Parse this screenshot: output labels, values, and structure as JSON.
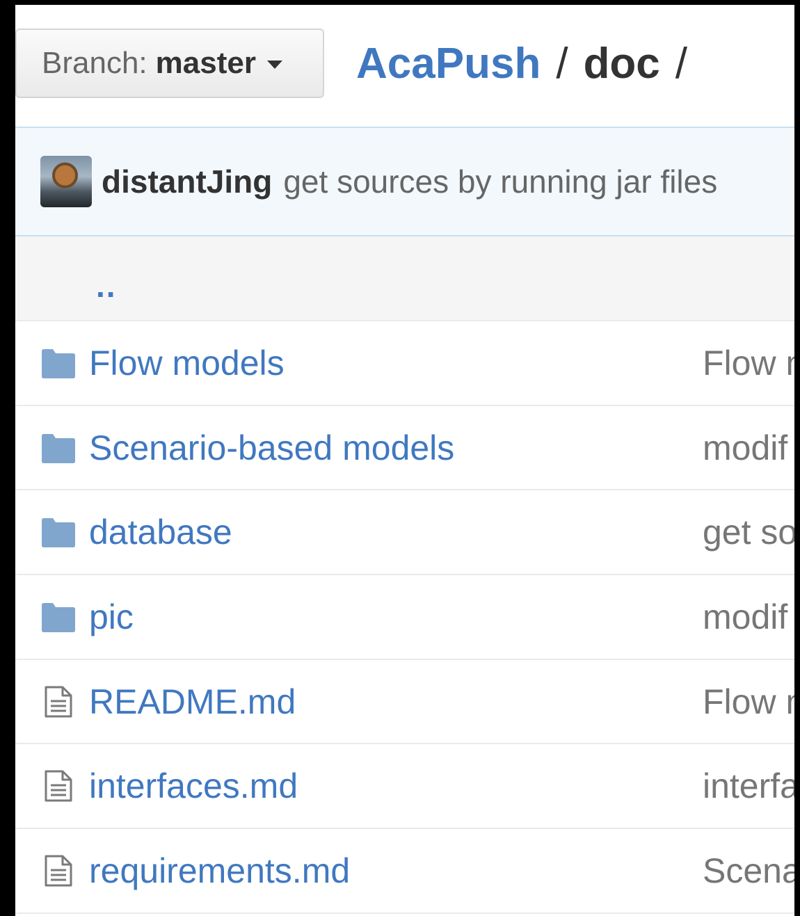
{
  "header": {
    "branch_prefix": "Branch:",
    "branch_name": "master",
    "repo": "AcaPush",
    "separator": "/",
    "directory": "doc",
    "trailing_separator": "/"
  },
  "commit": {
    "author": "distantJing",
    "message": "get sources by running jar files"
  },
  "parent_dir": "..",
  "files": [
    {
      "type": "folder",
      "name": "Flow models",
      "message": "Flow m"
    },
    {
      "type": "folder",
      "name": "Scenario-based models",
      "message": "modif"
    },
    {
      "type": "folder",
      "name": "database",
      "message": "get so"
    },
    {
      "type": "folder",
      "name": "pic",
      "message": "modif"
    },
    {
      "type": "file",
      "name": "README.md",
      "message": "Flow m"
    },
    {
      "type": "file",
      "name": "interfaces.md",
      "message": "interfa"
    },
    {
      "type": "file",
      "name": "requirements.md",
      "message": "Scena"
    }
  ],
  "colors": {
    "link": "#4078c0",
    "folder_icon": "#80a6cd",
    "commit_bar_bg": "#f2f8fc"
  }
}
